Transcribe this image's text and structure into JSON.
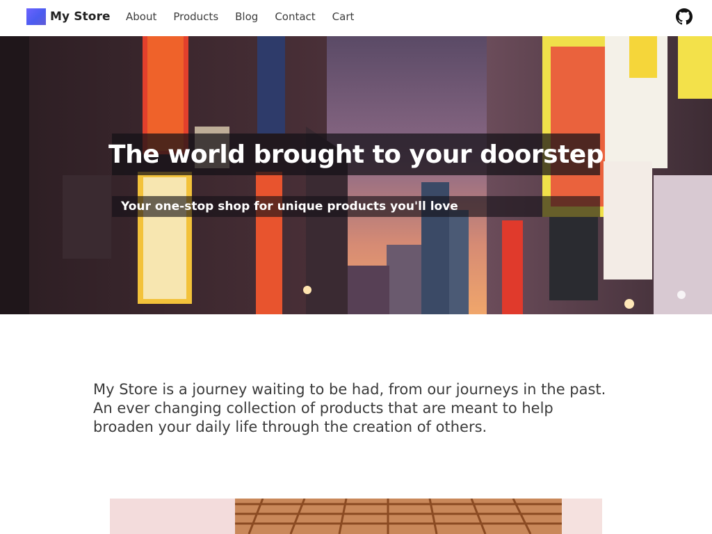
{
  "brand": {
    "name": "My Store",
    "logo_colors": [
      "#6c63ff",
      "#4b5cf0"
    ]
  },
  "nav": {
    "links": [
      "About",
      "Products",
      "Blog",
      "Contact",
      "Cart"
    ]
  },
  "header_icons": {
    "github": "github-icon"
  },
  "hero": {
    "title": "The world brought to your doorstep",
    "subtitle": "Your one-stop shop for unique products you'll love"
  },
  "intro": {
    "text": "My Store is a journey waiting to be had, from our journeys in the past. An ever changing collection of products that are meant to help broaden your daily life through the creation of others."
  },
  "colors": {
    "text_primary": "#3a3a3a",
    "hero_overlay": "#141016",
    "accent": "#5b5ff2"
  }
}
